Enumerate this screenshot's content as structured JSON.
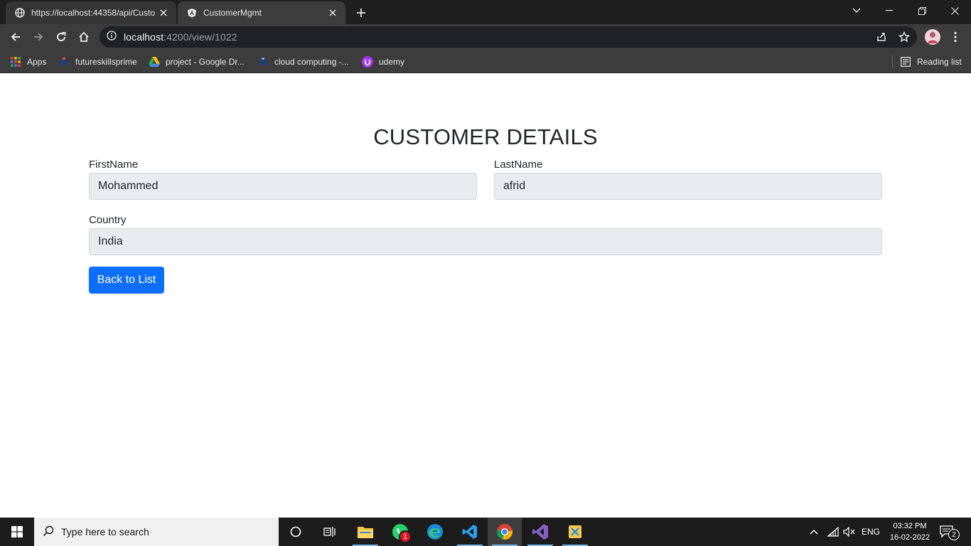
{
  "browser": {
    "tabs": [
      {
        "title": "https://localhost:44358/api/Custo",
        "favicon": "globe-icon"
      },
      {
        "title": "CustomerMgmt",
        "favicon": "angular-icon"
      }
    ],
    "address": {
      "host": "localhost",
      "path": ":4200/view/1022"
    },
    "bookmarks": [
      {
        "label": "Apps",
        "icon": "apps-grid-icon"
      },
      {
        "label": "futureskillsprime",
        "icon": "bookmark-icon"
      },
      {
        "label": "project - Google Dr...",
        "icon": "google-drive-icon"
      },
      {
        "label": "cloud computing -...",
        "icon": "bookmark-icon"
      },
      {
        "label": "udemy",
        "icon": "udemy-icon"
      }
    ],
    "reading_list": "Reading list"
  },
  "page": {
    "heading": "CUSTOMER DETAILS",
    "first_name": {
      "label": "FirstName",
      "value": "Mohammed"
    },
    "last_name": {
      "label": "LastName",
      "value": "afrid"
    },
    "country": {
      "label": "Country",
      "value": "India"
    },
    "back_button": "Back to List"
  },
  "taskbar": {
    "search_placeholder": "Type here to search",
    "whatsapp_badge": "1",
    "language": "ENG",
    "time": "03:32 PM",
    "date": "16-02-2022",
    "notification_count": "2"
  },
  "colors": {
    "primary_button": "#0d6efd",
    "readonly_field": "#e9ecef"
  }
}
